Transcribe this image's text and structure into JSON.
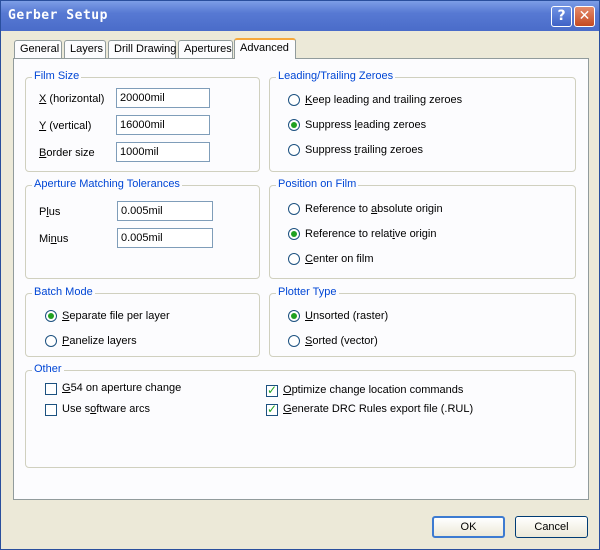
{
  "window": {
    "title": "Gerber Setup",
    "help_glyph": "?",
    "close_glyph": "✕"
  },
  "tabs": [
    "General",
    "Layers",
    "Drill Drawing",
    "Apertures",
    "Advanced"
  ],
  "film_size": {
    "title": "Film Size",
    "x_key": "X",
    "x_rest": " (horizontal)",
    "x_value": "20000mil",
    "y_key": "Y",
    "y_rest": " (vertical)",
    "y_value": "16000mil",
    "b_key": "B",
    "b_rest": "order size",
    "b_value": "1000mil"
  },
  "leading": {
    "title": "Leading/Trailing Zeroes",
    "o1_key": "K",
    "o1_rest": "eep leading and trailing zeroes",
    "o2_pre": "Suppress ",
    "o2_key": "l",
    "o2_rest": "eading zeroes",
    "o3_pre": "Suppress ",
    "o3_key": "t",
    "o3_rest": "railing zeroes"
  },
  "aperture": {
    "title": "Aperture Matching Tolerances",
    "plus_pre": "P",
    "plus_key": "l",
    "plus_rest": "us",
    "plus_value": "0.005mil",
    "minus_pre": "Mi",
    "minus_key": "n",
    "minus_rest": "us",
    "minus_value": "0.005mil"
  },
  "position": {
    "title": "Position on Film",
    "o1_pre": "Reference to ",
    "o1_key": "a",
    "o1_rest": "bsolute origin",
    "o2_pre": "Reference to relat",
    "o2_key": "i",
    "o2_rest": "ve origin",
    "o3_key": "C",
    "o3_rest": "enter on film"
  },
  "batch": {
    "title": "Batch Mode",
    "o1_key": "S",
    "o1_rest": "eparate file per layer",
    "o2_key": "P",
    "o2_rest": "anelize layers"
  },
  "plotter": {
    "title": "Plotter Type",
    "o1_key": "U",
    "o1_rest": "nsorted (raster)",
    "o2_key": "S",
    "o2_rest": "orted (vector)"
  },
  "other": {
    "title": "Other",
    "c1_key": "G",
    "c1_rest": "54 on aperture change",
    "c2_pre": "Use s",
    "c2_key": "o",
    "c2_rest": "ftware arcs",
    "c3_key": "O",
    "c3_rest": "ptimize change location commands",
    "c4_key": "G",
    "c4_rest": "enerate DRC Rules export file (.RUL)"
  },
  "buttons": {
    "ok": "OK",
    "cancel": "Cancel"
  }
}
